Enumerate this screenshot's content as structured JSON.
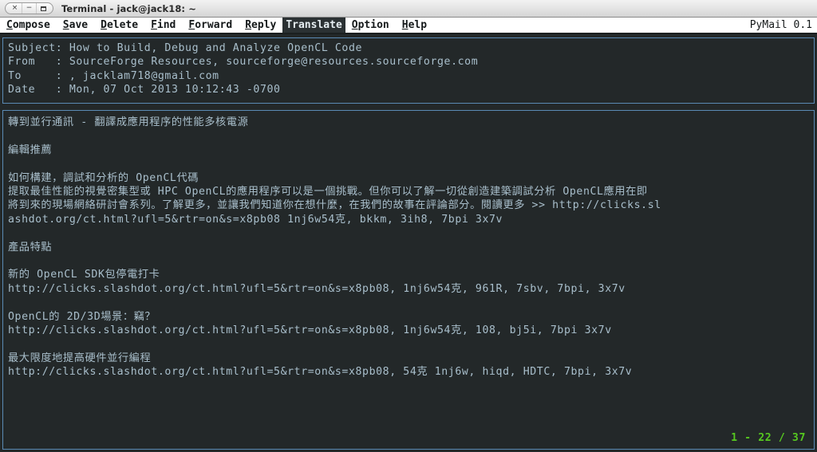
{
  "titlebar": {
    "title": "Terminal - jack@jack18: ~",
    "buttons": [
      {
        "name": "close",
        "glyph": "×"
      },
      {
        "name": "minimize",
        "glyph": "−"
      },
      {
        "name": "maximize",
        "glyph": "□"
      }
    ]
  },
  "menubar": {
    "items": [
      {
        "label": "Compose",
        "hotkey": "C",
        "selected": false
      },
      {
        "label": "Save",
        "hotkey": "S",
        "selected": false
      },
      {
        "label": "Delete",
        "hotkey": "D",
        "selected": false
      },
      {
        "label": "Find",
        "hotkey": "F",
        "selected": false
      },
      {
        "label": "Forward",
        "hotkey": "F",
        "selected": false
      },
      {
        "label": "Reply",
        "hotkey": "R",
        "selected": false
      },
      {
        "label": "Translate",
        "hotkey": "T",
        "selected": true
      },
      {
        "label": "Option",
        "hotkey": "O",
        "selected": false
      },
      {
        "label": "Help",
        "hotkey": "H",
        "selected": false
      }
    ],
    "app_version": "PyMail 0.1"
  },
  "header": {
    "lines": [
      "Subject: How to Build, Debug and Analyze OpenCL Code",
      "From   : SourceForge Resources, sourceforge@resources.sourceforge.com",
      "To     : , jacklam718@gmail.com",
      "Date   : Mon, 07 Oct 2013 10:12:43 -0700"
    ],
    "fields": {
      "subject_label": "Subject:",
      "subject_value": "How to Build, Debug and Analyze OpenCL Code",
      "from_label": "From   :",
      "from_value": "SourceForge Resources, sourceforge@resources.sourceforge.com",
      "to_label": "To     :",
      "to_value": ", jacklam718@gmail.com",
      "date_label": "Date   :",
      "date_value": "Mon, 07 Oct 2013 10:12:43 -0700"
    }
  },
  "body": {
    "lines": [
      "轉到並行通訊 - 翻譯成應用程序的性能多核電源",
      "",
      "編輯推薦",
      "",
      "如何構建，調試和分析的 OpenCL代碼",
      "提取最佳性能的視覺密集型或 HPC OpenCL的應用程序可以是一個挑戰。但你可以了解一切從創造建築調試分析 OpenCL應用在即",
      "將到來的現場網絡研討會系列。了解更多，並讓我們知道你在想什麼，在我們的故事在評論部分。閱讀更多 >> http://clicks.sl",
      "ashdot.org/ct.html?ufl=5&rtr=on&s=x8pb08 1nj6w54克, bkkm, 3ih8, 7bpi 3x7v",
      "",
      "產品特點",
      "",
      "新的 OpenCL SDK包停電打卡",
      "http://clicks.slashdot.org/ct.html?ufl=5&rtr=on&s=x8pb08, 1nj6w54克, 961R, 7sbv, 7bpi, 3x7v",
      "",
      "OpenCL的 2D/3D場景：竊？",
      "http://clicks.slashdot.org/ct.html?ufl=5&rtr=on&s=x8pb08, 1nj6w54克, 108, bj5i, 7bpi 3x7v",
      "",
      "最大限度地提高硬件並行編程",
      "http://clicks.slashdot.org/ct.html?ufl=5&rtr=on&s=x8pb08, 54克 1nj6w, hiqd, HDTC, 7bpi, 3x7v"
    ]
  },
  "status": {
    "pager": "1 - 22 / 37",
    "color": "#56c820"
  },
  "colors": {
    "terminal_bg": "#232829",
    "panel_border": "#5b8bb5",
    "body_text": "#a9bfcc",
    "menu_bg": "#ffffff",
    "menu_text": "#15191a",
    "menu_selected_bg": "#2b3133",
    "menu_selected_text": "#e6eef2"
  }
}
